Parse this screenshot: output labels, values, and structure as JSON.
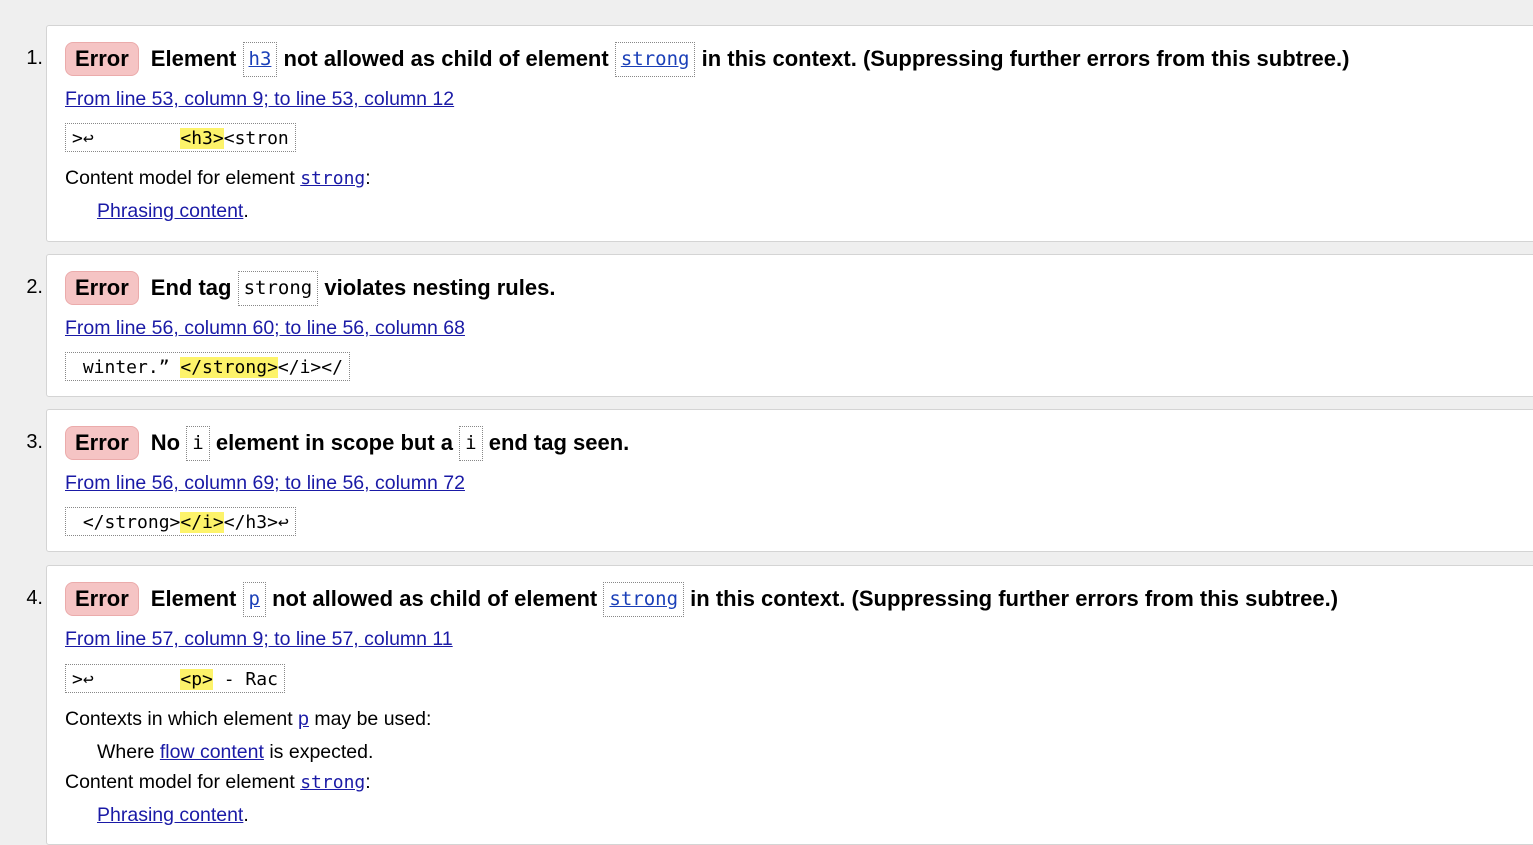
{
  "messages": [
    {
      "number": "1.",
      "badge": "Error",
      "t1": "Element",
      "c1": "h3",
      "t2": "not allowed as child of element",
      "c2": "strong",
      "t3": "in this context. (Suppressing further errors from this subtree.)",
      "location": "From line 53, column 9; to line 53, column 12",
      "extract_pre": ">↩        ",
      "extract_hl": "<h3>",
      "extract_post": "<stron",
      "cm_label": "Content model for element",
      "cm_el": "strong",
      "cm_colon": ":",
      "cm_value": "Phrasing content",
      "cm_period": "."
    },
    {
      "number": "2.",
      "badge": "Error",
      "t1": "End tag",
      "c1": "strong",
      "t2": "violates nesting rules.",
      "location": "From line 56, column 60; to line 56, column 68",
      "extract_pre": " winter.” ",
      "extract_hl": "</strong>",
      "extract_post": "</i></"
    },
    {
      "number": "3.",
      "badge": "Error",
      "t1": "No",
      "c1": "i",
      "t2": "element in scope but a",
      "c2": "i",
      "t3": "end tag seen.",
      "location": "From line 56, column 69; to line 56, column 72",
      "extract_pre": " </strong>",
      "extract_hl": "</i>",
      "extract_post": "</h3>↩"
    },
    {
      "number": "4.",
      "badge": "Error",
      "t1": "Element",
      "c1": "p",
      "t2": "not allowed as child of element",
      "c2": "strong",
      "t3": "in this context. (Suppressing further errors from this subtree.)",
      "location": "From line 57, column 9; to line 57, column 11",
      "extract_pre": ">↩        ",
      "extract_hl": "<p>",
      "extract_post": " - Rac",
      "ctx_label_a": "Contexts in which element",
      "ctx_el": "p",
      "ctx_label_b": "may be used:",
      "ctx_where": "Where",
      "ctx_link": "flow content",
      "ctx_tail": "is expected.",
      "cm_label": "Content model for element",
      "cm_el": "strong",
      "cm_colon": ":",
      "cm_value": "Phrasing content",
      "cm_period": "."
    }
  ]
}
